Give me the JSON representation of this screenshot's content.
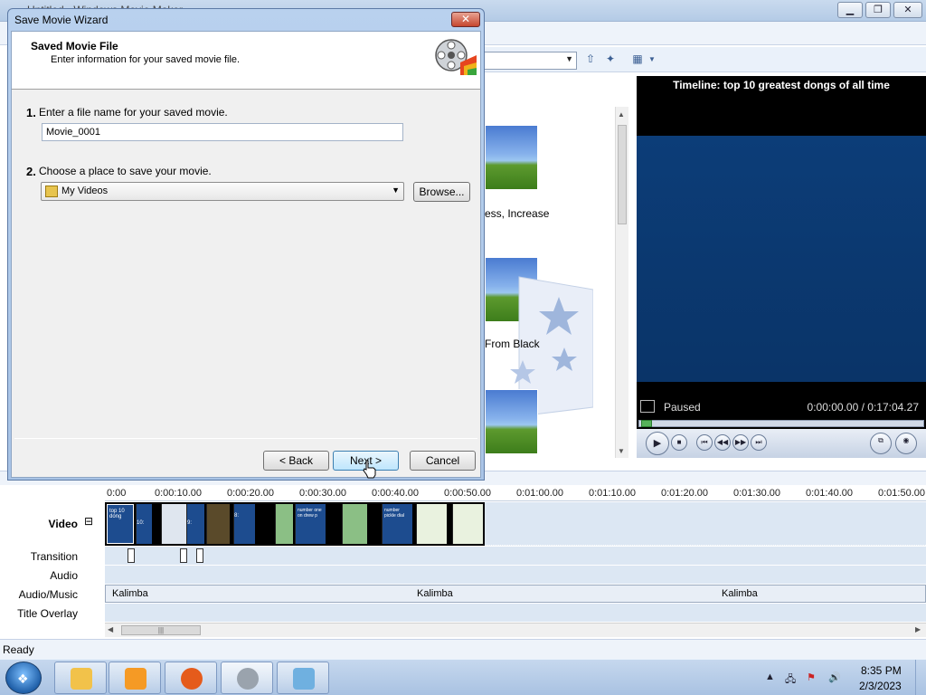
{
  "app": {
    "title": "Untitled - Windows Movie Maker",
    "minimize_icon": "minimize-icon",
    "maximize_icon": "restore-icon",
    "close_icon": "close-icon"
  },
  "content": {
    "effect_labels": [
      "ess, Increase",
      "From Black"
    ]
  },
  "preview": {
    "title": "Timeline: top 10 greatest dongs of all time",
    "state": "Paused",
    "time": "0:00:00.00 / 0:17:04.27"
  },
  "timeline": {
    "ruler": [
      "0:00",
      "0:00:10.00",
      "0:00:20.00",
      "0:00:30.00",
      "0:00:40.00",
      "0:00:50.00",
      "0:01:00.00",
      "0:01:10.00",
      "0:01:20.00",
      "0:01:30.00",
      "0:01:40.00",
      "0:01:50.00"
    ],
    "tracks": {
      "video": "Video",
      "collapse": "⊟",
      "transition": "Transition",
      "audio": "Audio",
      "music": "Audio/Music",
      "overlay": "Title Overlay"
    },
    "music_clips": [
      "Kalimba",
      "Kalimba",
      "Kalimba"
    ],
    "clip_texts": [
      "top 10 dong",
      "10:",
      "9: ",
      "8:",
      "number one on drew p",
      "number pickle dial"
    ]
  },
  "status": "Ready",
  "dialog": {
    "title": "Save Movie Wizard",
    "close_label": "✕",
    "heading": "Saved Movie File",
    "subheading": "Enter information for your saved movie file.",
    "step1_num": "1.",
    "step1_text": "Enter a file name for your saved movie.",
    "filename_value": "Movie_0001",
    "step2_num": "2.",
    "step2_text": "Choose a place to save your movie.",
    "location_value": "My Videos",
    "browse_label": "Browse...",
    "back_label": "< Back",
    "next_label": "Next >",
    "cancel_label": "Cancel"
  },
  "taskbar": {
    "apps": [
      "file-explorer-icon",
      "media-player-icon",
      "firefox-icon",
      "movie-maker-icon",
      "paint-icon"
    ],
    "time": "8:35 PM",
    "date": "2/3/2023"
  },
  "colors": {
    "accent": "#1f5fa8",
    "preview_screen": "#0c3d78",
    "track_bg": "#dce7f3"
  }
}
